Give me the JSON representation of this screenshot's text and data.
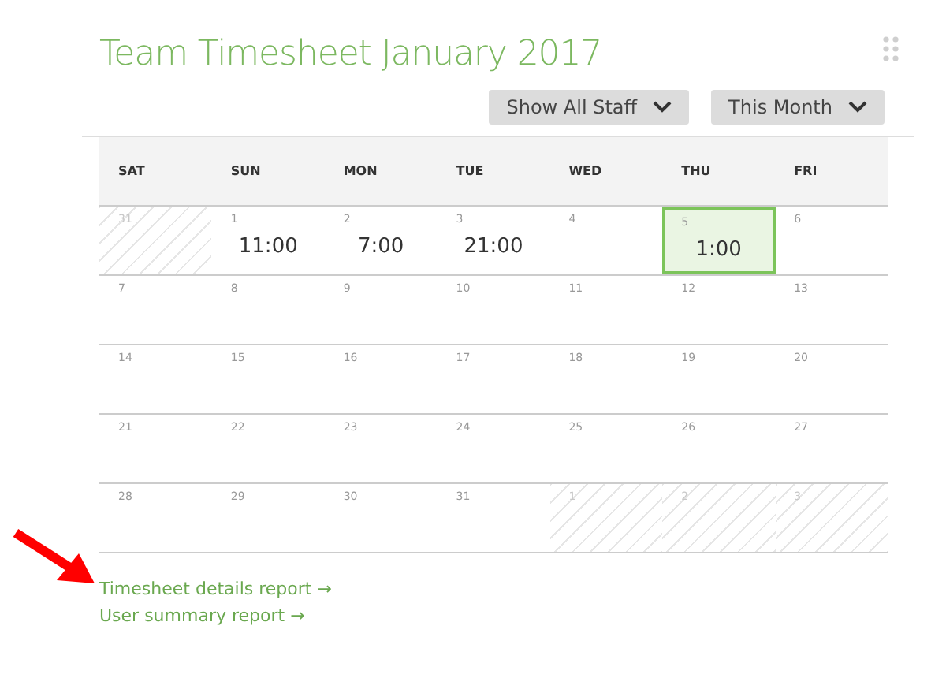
{
  "title": "Team Timesheet January 2017",
  "filters": [
    {
      "label": "Show All Staff"
    },
    {
      "label": "This Month"
    }
  ],
  "weekdays": [
    "SAT",
    "SUN",
    "MON",
    "TUE",
    "WED",
    "THU",
    "FRI"
  ],
  "weeks": [
    [
      {
        "day": "31",
        "outside": true,
        "selected": false
      },
      {
        "day": "1",
        "hours": "11:00",
        "outside": false,
        "selected": false
      },
      {
        "day": "2",
        "hours": "7:00",
        "outside": false,
        "selected": false
      },
      {
        "day": "3",
        "hours": "21:00",
        "outside": false,
        "selected": false
      },
      {
        "day": "4",
        "outside": false,
        "selected": false
      },
      {
        "day": "5",
        "hours": "1:00",
        "outside": false,
        "selected": true
      },
      {
        "day": "6",
        "outside": false,
        "selected": false
      }
    ],
    [
      {
        "day": "7",
        "outside": false,
        "selected": false
      },
      {
        "day": "8",
        "outside": false,
        "selected": false
      },
      {
        "day": "9",
        "outside": false,
        "selected": false
      },
      {
        "day": "10",
        "outside": false,
        "selected": false
      },
      {
        "day": "11",
        "outside": false,
        "selected": false
      },
      {
        "day": "12",
        "outside": false,
        "selected": false
      },
      {
        "day": "13",
        "outside": false,
        "selected": false
      }
    ],
    [
      {
        "day": "14",
        "outside": false,
        "selected": false
      },
      {
        "day": "15",
        "outside": false,
        "selected": false
      },
      {
        "day": "16",
        "outside": false,
        "selected": false
      },
      {
        "day": "17",
        "outside": false,
        "selected": false
      },
      {
        "day": "18",
        "outside": false,
        "selected": false
      },
      {
        "day": "19",
        "outside": false,
        "selected": false
      },
      {
        "day": "20",
        "outside": false,
        "selected": false
      }
    ],
    [
      {
        "day": "21",
        "outside": false,
        "selected": false
      },
      {
        "day": "22",
        "outside": false,
        "selected": false
      },
      {
        "day": "23",
        "outside": false,
        "selected": false
      },
      {
        "day": "24",
        "outside": false,
        "selected": false
      },
      {
        "day": "25",
        "outside": false,
        "selected": false
      },
      {
        "day": "26",
        "outside": false,
        "selected": false
      },
      {
        "day": "27",
        "outside": false,
        "selected": false
      }
    ],
    [
      {
        "day": "28",
        "outside": false,
        "selected": false
      },
      {
        "day": "29",
        "outside": false,
        "selected": false
      },
      {
        "day": "30",
        "outside": false,
        "selected": false
      },
      {
        "day": "31",
        "outside": false,
        "selected": false
      },
      {
        "day": "1",
        "outside": true,
        "selected": false
      },
      {
        "day": "2",
        "outside": true,
        "selected": false
      },
      {
        "day": "3",
        "outside": true,
        "selected": false
      }
    ]
  ],
  "links": [
    "Timesheet details report →",
    "User summary report →"
  ]
}
